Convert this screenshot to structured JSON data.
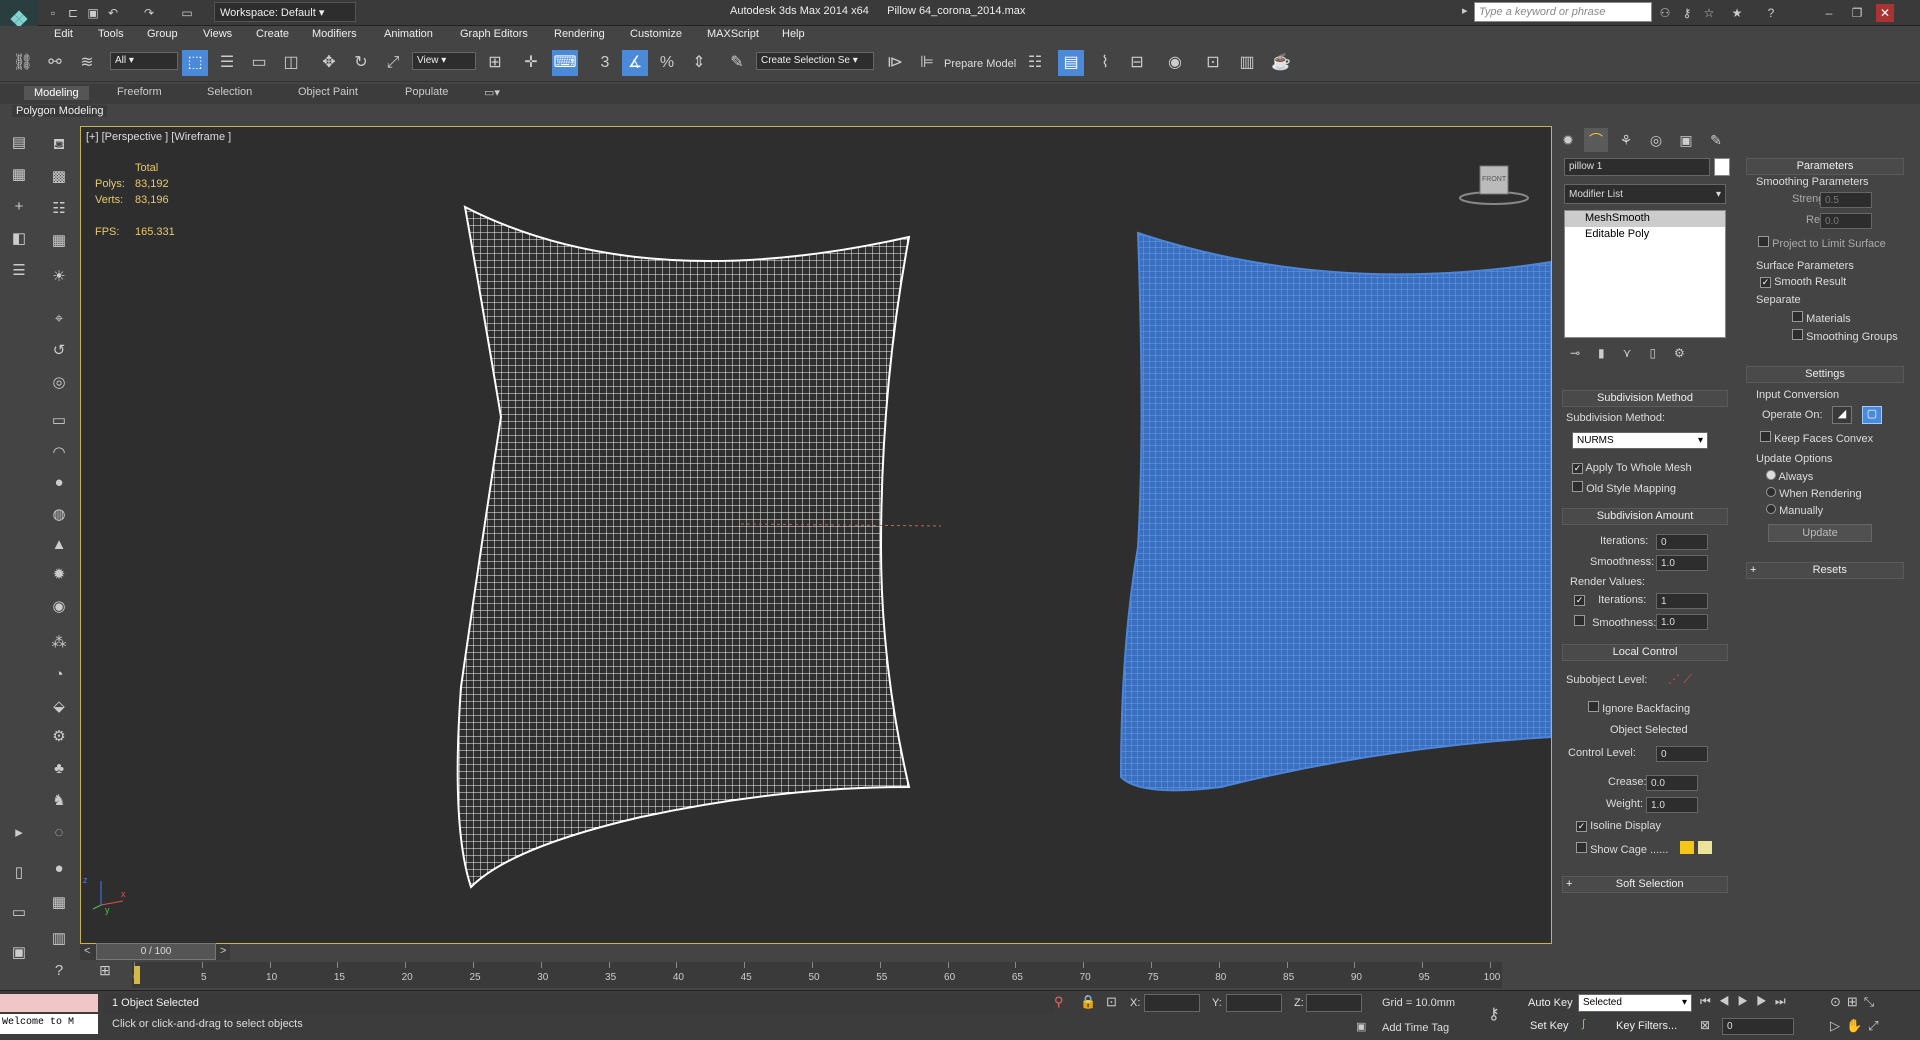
{
  "titlebar": {
    "workspace": "Workspace: Default",
    "app_title": "Autodesk 3ds Max  2014 x64",
    "file_title": "Pillow 64_corona_2014.max",
    "search_placeholder": "Type a keyword or phrase"
  },
  "menu": [
    "Edit",
    "Tools",
    "Group",
    "Views",
    "Create",
    "Modifiers",
    "Animation",
    "Graph Editors",
    "Rendering",
    "Customize",
    "MAXScript",
    "Help"
  ],
  "toolbar": {
    "filter": "All",
    "ref_coord": "View",
    "snap_angle": "3",
    "selection_set": "Create Selection Se",
    "prepare_model": "Prepare Model"
  },
  "ribbon": {
    "tabs": [
      "Modeling",
      "Freeform",
      "Selection",
      "Object Paint",
      "Populate"
    ],
    "active": "Modeling",
    "sub": "Polygon Modeling"
  },
  "viewport": {
    "label": "[+] [Perspective ] [Wireframe ]",
    "total_label": "Total",
    "polys_label": "Polys:",
    "polys": "83,192",
    "verts_label": "Verts:",
    "verts": "83,196",
    "fps_label": "FPS:",
    "fps": "165.331",
    "viewcube_label": "FRONT",
    "axis_x": "x",
    "axis_y": "y",
    "axis_z": "z"
  },
  "modify": {
    "object_name": "pillow 1",
    "modifier_list": "Modifier List",
    "stack": [
      "MeshSmooth",
      "Editable Poly"
    ],
    "subdivision_method": {
      "title": "Subdivision Method",
      "label": "Subdivision Method:",
      "value": "NURMS",
      "apply_whole": "Apply To Whole Mesh",
      "old_style": "Old Style Mapping"
    },
    "subdivision_amount": {
      "title": "Subdivision Amount",
      "iterations_label": "Iterations:",
      "iterations": "0",
      "smoothness_label": "Smoothness:",
      "smoothness": "1.0",
      "render_values": "Render Values:",
      "r_iterations": "1",
      "r_smoothness": "1.0"
    },
    "local_control": {
      "title": "Local Control",
      "subobject": "Subobject Level:",
      "ignore_backfacing": "Ignore Backfacing",
      "object_selected": "Object Selected",
      "control_level_label": "Control Level:",
      "control_level": "0",
      "crease_label": "Crease:",
      "crease": "0.0",
      "weight_label": "Weight:",
      "weight": "1.0",
      "isoline": "Isoline Display",
      "show_cage": "Show Cage ......"
    },
    "soft_selection": "Soft Selection",
    "parameters": {
      "title": "Parameters",
      "smoothing": "Smoothing Parameters",
      "strength_label": "Strength:",
      "strength": "0.5",
      "relax_label": "Relax:",
      "relax": "0.0",
      "project": "Project to Limit Surface",
      "surface": "Surface Parameters",
      "smooth_result": "Smooth Result",
      "separate": "Separate",
      "materials": "Materials",
      "smoothing_groups": "Smoothing Groups"
    },
    "settings": {
      "title": "Settings",
      "input_conversion": "Input Conversion",
      "operate_on": "Operate On:",
      "keep_faces": "Keep Faces Convex",
      "update_options": "Update Options",
      "always": "Always",
      "when_rendering": "When Rendering",
      "manually": "Manually",
      "update": "Update"
    },
    "resets": "Resets"
  },
  "timeline": {
    "frame": "0 / 100",
    "ticks": [
      "0",
      "5",
      "10",
      "15",
      "20",
      "25",
      "30",
      "35",
      "40",
      "45",
      "50",
      "55",
      "60",
      "65",
      "70",
      "75",
      "80",
      "85",
      "90",
      "95",
      "100"
    ]
  },
  "status": {
    "maxscript": "Welcome to M",
    "selected": "1 Object Selected",
    "prompt": "Click or click-and-drag to select objects",
    "x": "X:",
    "y": "Y:",
    "z": "Z:",
    "grid": "Grid = 10.0mm",
    "add_time_tag": "Add Time Tag",
    "auto_key": "Auto Key",
    "set_key": "Set Key",
    "key_mode": "Selected",
    "key_filters": "Key Filters...",
    "frame": "0"
  },
  "colors": {
    "accent": "#4a8ad8",
    "viewport_border": "#c8b255",
    "pillow_blue": "#4d86d9",
    "stats": "#e8c86a"
  }
}
